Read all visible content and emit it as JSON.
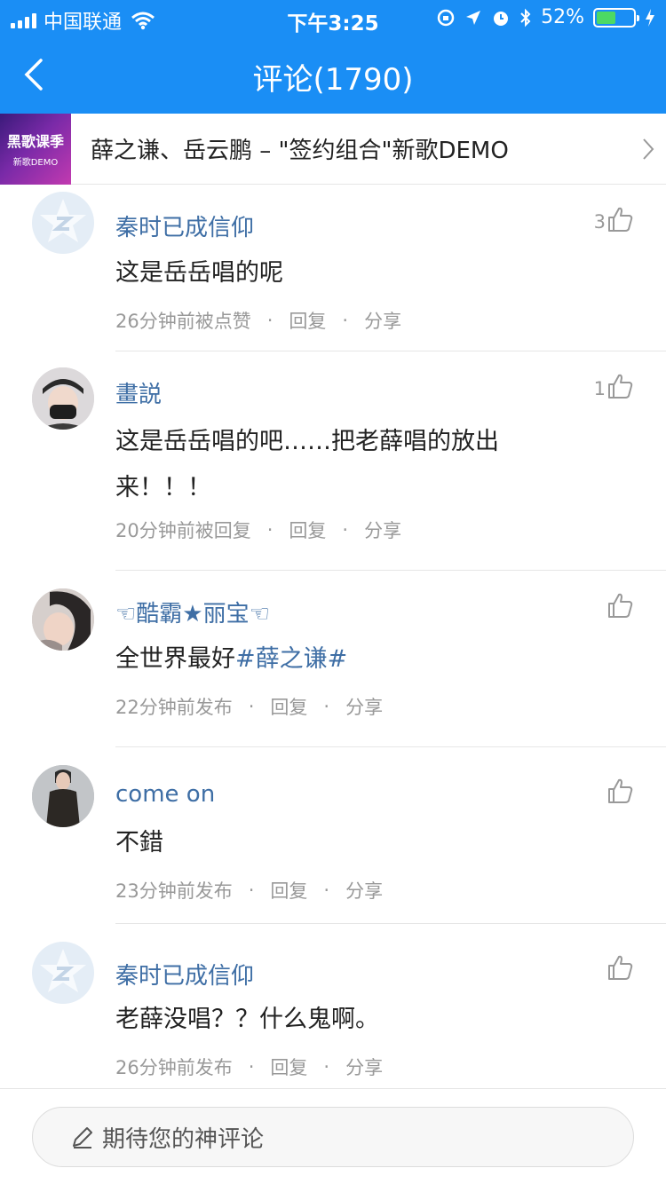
{
  "status_bar": {
    "carrier": "中国联通",
    "time": "下午3:25",
    "battery_percent": "52%",
    "battery_level": 0.52
  },
  "nav": {
    "title": "评论(1790)",
    "back_icon": "chevron-left-icon"
  },
  "song": {
    "title": "薛之谦、岳云鹏 – \"签约组合\"新歌DEMO",
    "cover_text_1": "黑歌课季",
    "cover_text_2": "新歌DEMO"
  },
  "comments": [
    {
      "user": "秦时已成信仰",
      "text": "这是岳岳唱的呢",
      "time": "26分钟前被点赞",
      "reply": "回复",
      "share": "分享",
      "likes": "3"
    },
    {
      "user": "畫説",
      "text": "这是岳岳唱的吧……把老薛唱的放出来！！！",
      "time": "20分钟前被回复",
      "reply": "回复",
      "share": "分享",
      "likes": "1"
    },
    {
      "user": "☜酷霸★丽宝☜",
      "text_prefix": "全世界最好",
      "hashtag": "#薛之谦#",
      "time": "22分钟前发布",
      "reply": "回复",
      "share": "分享",
      "likes": ""
    },
    {
      "user": "come on",
      "text": "不錯",
      "time": "23分钟前发布",
      "reply": "回复",
      "share": "分享",
      "likes": ""
    },
    {
      "user": "秦时已成信仰",
      "text": "老薛没唱？？什么鬼啊。",
      "time": "26分钟前发布",
      "reply": "回复",
      "share": "分享",
      "likes": ""
    }
  ],
  "comment_input": {
    "placeholder": "期待您的神评论",
    "icon": "pencil-icon"
  },
  "colors": {
    "brand": "#1a8ef5",
    "username": "#3e6ea5",
    "meta": "#999999"
  }
}
